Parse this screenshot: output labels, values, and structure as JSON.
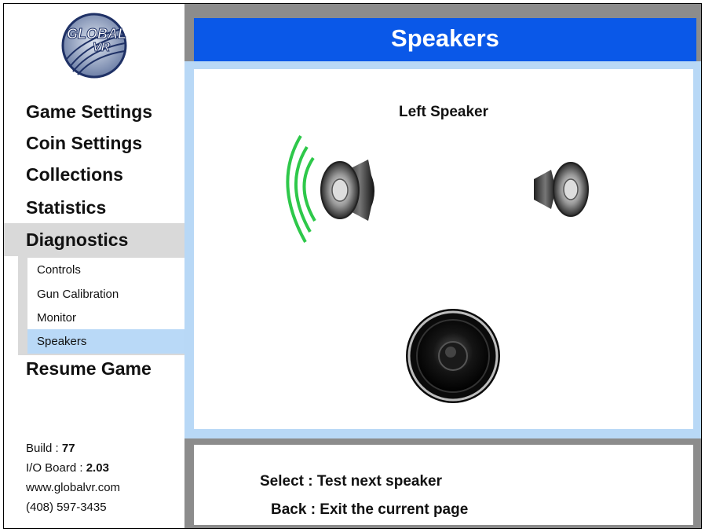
{
  "brand": {
    "logo_text": "GLOBAL VR"
  },
  "sidebar": {
    "menu": [
      {
        "label": "Game Settings"
      },
      {
        "label": "Coin Settings"
      },
      {
        "label": "Collections"
      },
      {
        "label": "Statistics"
      },
      {
        "label": "Diagnostics",
        "state": "expanded"
      }
    ],
    "submenu": [
      {
        "label": "Controls"
      },
      {
        "label": "Gun Calibration"
      },
      {
        "label": "Monitor"
      },
      {
        "label": "Speakers",
        "state": "selected"
      }
    ],
    "resume": {
      "label": "Resume Game"
    },
    "info": {
      "build_label": "Build :",
      "build_value": "77",
      "io_label": "I/O Board :",
      "io_value": "2.03",
      "website": "www.globalvr.com",
      "phone": "(408) 597-3435"
    }
  },
  "main": {
    "title": "Speakers",
    "speaker_label": "Left Speaker",
    "speakers": [
      {
        "name": "left",
        "active": true,
        "icon": "speaker-left-icon"
      },
      {
        "name": "right",
        "active": false,
        "icon": "speaker-right-icon"
      },
      {
        "name": "subwoofer",
        "active": false,
        "icon": "subwoofer-icon"
      }
    ],
    "hints": [
      {
        "text": "Select : Test next speaker"
      },
      {
        "text": "Back : Exit the current page"
      }
    ]
  },
  "colors": {
    "title_bar": "#0a58e8",
    "panel_border": "#b8d8f6",
    "selection": "#b9d9f7",
    "menu_highlight": "#d9d9d9",
    "frame_gray": "#8c8c8c",
    "sound_wave": "#2ec84a"
  }
}
